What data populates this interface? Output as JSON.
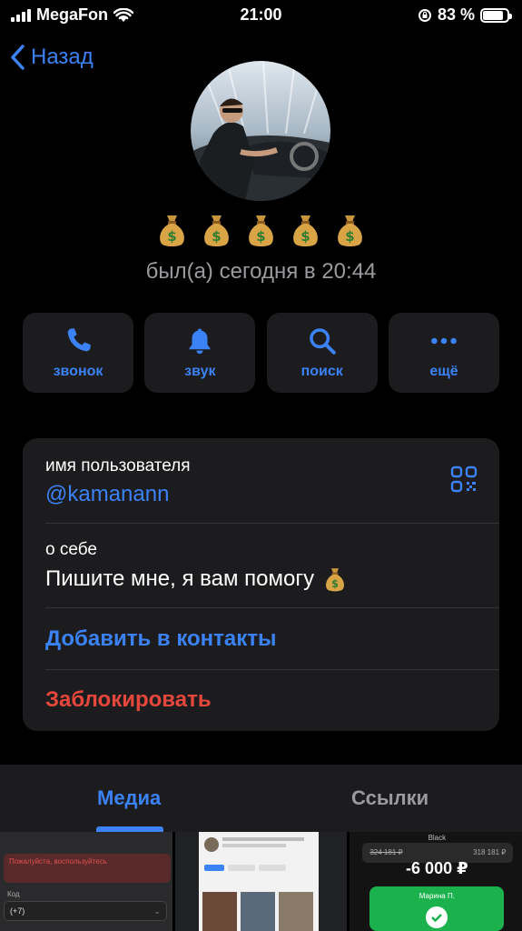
{
  "status": {
    "carrier": "MegaFon",
    "time": "21:00",
    "battery": "83 %",
    "battery_level": 0.83
  },
  "nav": {
    "back_label": "Назад"
  },
  "profile": {
    "last_seen": "был(а) сегодня в 20:44",
    "emoji": [
      "money-bag",
      "money-bag",
      "money-bag",
      "money-bag",
      "money-bag"
    ]
  },
  "actions": [
    {
      "label": "звонок",
      "icon": "phone-icon"
    },
    {
      "label": "звук",
      "icon": "bell-icon"
    },
    {
      "label": "поиск",
      "icon": "search-icon"
    },
    {
      "label": "ещё",
      "icon": "more-icon"
    }
  ],
  "info": {
    "username_caption": "имя пользователя",
    "username": "@kamanann",
    "about_caption": "о себе",
    "about": "Пишите мне, я вам помогу",
    "add_contact": "Добавить в контакты",
    "block": "Заблокировать"
  },
  "tabs": {
    "media": "Медиа",
    "links": "Ссылки"
  },
  "media_preview": {
    "t1_text": "Пожалуйста, воспользуйтесь",
    "t1_code_label": "Код",
    "t1_code_value": "(+7)",
    "t3_title": "Black",
    "t3_old1": "324 181 ₽",
    "t3_old2": "318 181 ₽",
    "t3_amount": "-6 000 ₽",
    "t3_name": "Марина П."
  },
  "colors": {
    "accent": "#3b82f6",
    "danger": "#e5473c",
    "card": "#1c1c1e",
    "muted": "#9a9a9f"
  }
}
